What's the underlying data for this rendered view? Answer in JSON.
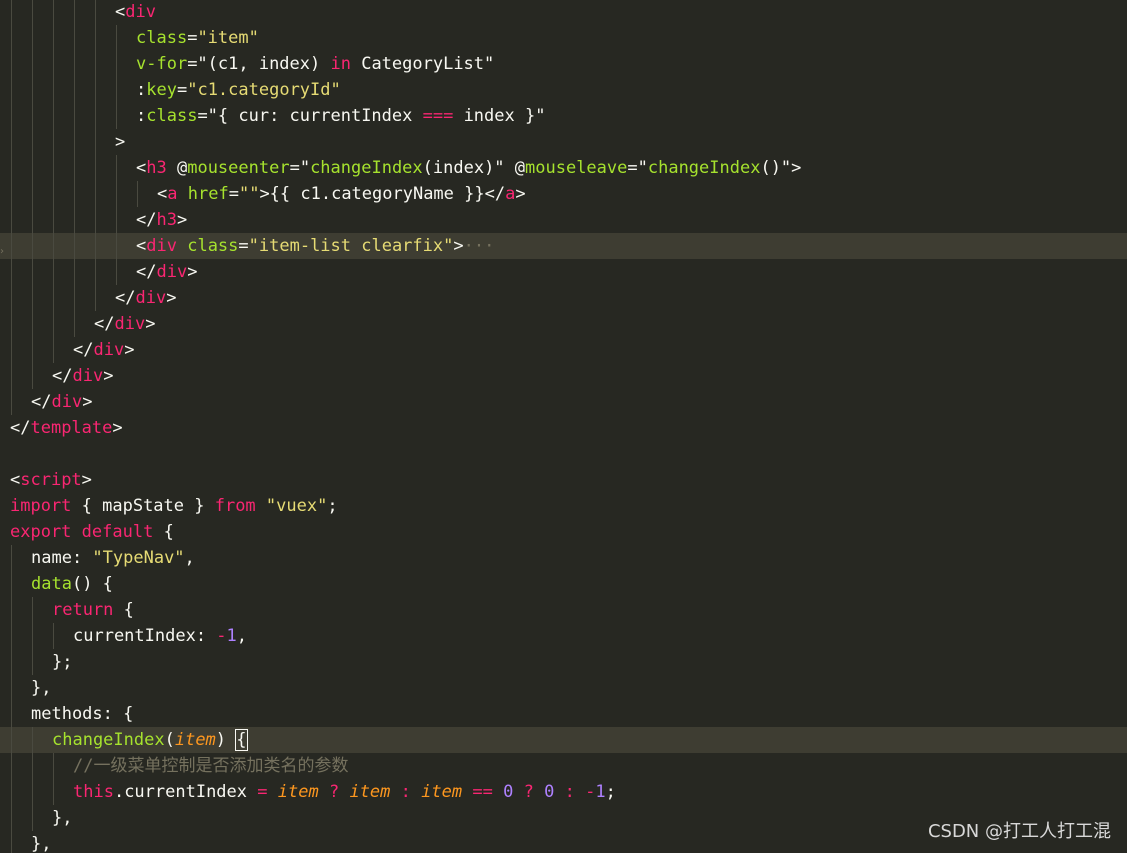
{
  "editor": {
    "theme": {
      "background": "#272822",
      "highlight": "#3e3d32",
      "tag": "#f92672",
      "attribute": "#a6e22e",
      "string": "#e6db74",
      "number": "#ae81ff",
      "parameter": "#fd971f",
      "comment": "#75715e",
      "text": "#f8f8f2"
    },
    "lines": [
      {
        "indent": 5,
        "highlight": false,
        "tokens": [
          [
            "p",
            "<"
          ],
          [
            "tag",
            "div"
          ]
        ]
      },
      {
        "indent": 6,
        "highlight": false,
        "tokens": [
          [
            "attr",
            "class"
          ],
          [
            "p",
            "="
          ],
          [
            "str",
            "\"item\""
          ]
        ]
      },
      {
        "indent": 6,
        "highlight": false,
        "tokens": [
          [
            "attr",
            "v-for"
          ],
          [
            "p",
            "=\"(c1, index) "
          ],
          [
            "kw",
            "in"
          ],
          [
            "p",
            " CategoryList\""
          ]
        ]
      },
      {
        "indent": 6,
        "highlight": false,
        "tokens": [
          [
            "p",
            ":"
          ],
          [
            "attr",
            "key"
          ],
          [
            "p",
            "="
          ],
          [
            "str",
            "\"c1.categoryId\""
          ]
        ]
      },
      {
        "indent": 6,
        "highlight": false,
        "tokens": [
          [
            "p",
            ":"
          ],
          [
            "attr",
            "class"
          ],
          [
            "p",
            "=\"{ cur: currentIndex "
          ],
          [
            "kw",
            "==="
          ],
          [
            "p",
            " index }\""
          ]
        ]
      },
      {
        "indent": 5,
        "highlight": false,
        "tokens": [
          [
            "p",
            ">"
          ]
        ]
      },
      {
        "indent": 6,
        "highlight": false,
        "tokens": [
          [
            "p",
            "<"
          ],
          [
            "tag",
            "h3"
          ],
          [
            "p",
            " @"
          ],
          [
            "attr",
            "mouseenter"
          ],
          [
            "p",
            "=\""
          ],
          [
            "fn",
            "changeIndex"
          ],
          [
            "p",
            "(index)\" @"
          ],
          [
            "attr",
            "mouseleave"
          ],
          [
            "p",
            "=\""
          ],
          [
            "fn",
            "changeIndex"
          ],
          [
            "p",
            "()\">"
          ]
        ]
      },
      {
        "indent": 7,
        "highlight": false,
        "tokens": [
          [
            "p",
            "<"
          ],
          [
            "tag",
            "a"
          ],
          [
            "p",
            " "
          ],
          [
            "attr",
            "href"
          ],
          [
            "p",
            "="
          ],
          [
            "str",
            "\"\""
          ],
          [
            "p",
            ">{{ c1.categoryName }}</"
          ],
          [
            "tag",
            "a"
          ],
          [
            "p",
            ">"
          ]
        ]
      },
      {
        "indent": 6,
        "highlight": false,
        "tokens": [
          [
            "p",
            "</"
          ],
          [
            "tag",
            "h3"
          ],
          [
            "p",
            ">"
          ]
        ]
      },
      {
        "indent": 6,
        "highlight": true,
        "fold": true,
        "tokens": [
          [
            "p",
            "<"
          ],
          [
            "tag",
            "div"
          ],
          [
            "p",
            " "
          ],
          [
            "attr",
            "class"
          ],
          [
            "p",
            "="
          ],
          [
            "str",
            "\"item-list clearfix\""
          ],
          [
            "p",
            ">"
          ],
          [
            "ellipsis",
            "···"
          ]
        ]
      },
      {
        "indent": 6,
        "highlight": false,
        "tokens": [
          [
            "p",
            "</"
          ],
          [
            "tag",
            "div"
          ],
          [
            "p",
            ">"
          ]
        ]
      },
      {
        "indent": 5,
        "highlight": false,
        "tokens": [
          [
            "p",
            "</"
          ],
          [
            "tag",
            "div"
          ],
          [
            "p",
            ">"
          ]
        ]
      },
      {
        "indent": 4,
        "highlight": false,
        "tokens": [
          [
            "p",
            "</"
          ],
          [
            "tag",
            "div"
          ],
          [
            "p",
            ">"
          ]
        ]
      },
      {
        "indent": 3,
        "highlight": false,
        "tokens": [
          [
            "p",
            "</"
          ],
          [
            "tag",
            "div"
          ],
          [
            "p",
            ">"
          ]
        ]
      },
      {
        "indent": 2,
        "highlight": false,
        "tokens": [
          [
            "p",
            "</"
          ],
          [
            "tag",
            "div"
          ],
          [
            "p",
            ">"
          ]
        ]
      },
      {
        "indent": 1,
        "highlight": false,
        "tokens": [
          [
            "p",
            "</"
          ],
          [
            "tag",
            "div"
          ],
          [
            "p",
            ">"
          ]
        ]
      },
      {
        "indent": 0,
        "highlight": false,
        "tokens": [
          [
            "p",
            "</"
          ],
          [
            "tag",
            "template"
          ],
          [
            "p",
            ">"
          ]
        ]
      },
      {
        "indent": 0,
        "highlight": false,
        "tokens": []
      },
      {
        "indent": 0,
        "highlight": false,
        "tokens": [
          [
            "p",
            "<"
          ],
          [
            "tag",
            "script"
          ],
          [
            "p",
            ">"
          ]
        ]
      },
      {
        "indent": 0,
        "highlight": false,
        "tokens": [
          [
            "kw",
            "import"
          ],
          [
            "p",
            " { mapState } "
          ],
          [
            "kw",
            "from"
          ],
          [
            "p",
            " "
          ],
          [
            "str",
            "\"vuex\""
          ],
          [
            "p",
            ";"
          ]
        ]
      },
      {
        "indent": 0,
        "highlight": false,
        "tokens": [
          [
            "kw",
            "export"
          ],
          [
            "p",
            " "
          ],
          [
            "kw",
            "default"
          ],
          [
            "p",
            " {"
          ]
        ]
      },
      {
        "indent": 1,
        "highlight": false,
        "tokens": [
          [
            "p",
            "name: "
          ],
          [
            "str",
            "\"TypeNav\""
          ],
          [
            "p",
            ","
          ]
        ]
      },
      {
        "indent": 1,
        "highlight": false,
        "tokens": [
          [
            "fn",
            "data"
          ],
          [
            "p",
            "() {"
          ]
        ]
      },
      {
        "indent": 2,
        "highlight": false,
        "tokens": [
          [
            "kw",
            "return"
          ],
          [
            "p",
            " {"
          ]
        ]
      },
      {
        "indent": 3,
        "highlight": false,
        "tokens": [
          [
            "p",
            "currentIndex: "
          ],
          [
            "kw",
            "-"
          ],
          [
            "num",
            "1"
          ],
          [
            "p",
            ","
          ]
        ]
      },
      {
        "indent": 2,
        "highlight": false,
        "tokens": [
          [
            "p",
            "};"
          ]
        ]
      },
      {
        "indent": 1,
        "highlight": false,
        "tokens": [
          [
            "p",
            "},"
          ]
        ]
      },
      {
        "indent": 1,
        "highlight": false,
        "tokens": [
          [
            "p",
            "methods: {"
          ]
        ]
      },
      {
        "indent": 2,
        "highlight": true,
        "tokens": [
          [
            "fn",
            "changeIndex"
          ],
          [
            "p",
            "("
          ],
          [
            "param",
            "item"
          ],
          [
            "p",
            ") "
          ],
          [
            "cursor",
            "{"
          ]
        ]
      },
      {
        "indent": 3,
        "highlight": false,
        "tokens": [
          [
            "comment",
            "//一级菜单控制是否添加类名的参数"
          ]
        ]
      },
      {
        "indent": 3,
        "highlight": false,
        "tokens": [
          [
            "kw",
            "this"
          ],
          [
            "p",
            ".currentIndex "
          ],
          [
            "kw",
            "="
          ],
          [
            "p",
            " "
          ],
          [
            "param",
            "item"
          ],
          [
            "p",
            " "
          ],
          [
            "kw",
            "?"
          ],
          [
            "p",
            " "
          ],
          [
            "param",
            "item"
          ],
          [
            "p",
            " "
          ],
          [
            "kw",
            ":"
          ],
          [
            "p",
            " "
          ],
          [
            "param",
            "item"
          ],
          [
            "p",
            " "
          ],
          [
            "kw",
            "=="
          ],
          [
            "p",
            " "
          ],
          [
            "num",
            "0"
          ],
          [
            "p",
            " "
          ],
          [
            "kw",
            "?"
          ],
          [
            "p",
            " "
          ],
          [
            "num",
            "0"
          ],
          [
            "p",
            " "
          ],
          [
            "kw",
            ":"
          ],
          [
            "p",
            " "
          ],
          [
            "kw",
            "-"
          ],
          [
            "num",
            "1"
          ],
          [
            "p",
            ";"
          ]
        ]
      },
      {
        "indent": 2,
        "highlight": false,
        "tokens": [
          [
            "p",
            "},"
          ]
        ]
      },
      {
        "indent": 1,
        "highlight": false,
        "tokens": [
          [
            "p",
            "},"
          ]
        ]
      }
    ]
  },
  "watermark": "CSDN @打工人打工混"
}
